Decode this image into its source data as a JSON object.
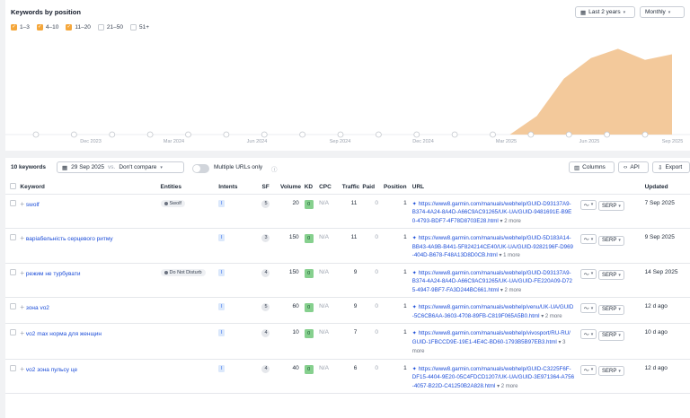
{
  "chart_panel": {
    "title": "Keywords by position",
    "legend": [
      {
        "label": "1–3",
        "checked": true
      },
      {
        "label": "4–10",
        "checked": true
      },
      {
        "label": "11–20",
        "checked": true
      },
      {
        "label": "21–50",
        "checked": false
      },
      {
        "label": "51+",
        "checked": false
      }
    ],
    "period_label": "Last 2 years",
    "interval_label": "Monthly"
  },
  "chart_data": {
    "type": "area",
    "x_labels": [
      "Dec 2023",
      "Mar 2024",
      "Jun 2024",
      "Sep 2024",
      "Dec 2024",
      "Mar 2025",
      "Jun 2025",
      "Sep 2025"
    ],
    "series": [
      {
        "values": [
          0,
          0,
          0,
          0,
          0,
          0,
          0,
          0,
          0,
          0,
          0,
          0,
          0,
          0,
          0,
          0,
          0,
          0,
          0,
          1,
          3,
          4.1,
          4.6,
          4.0,
          4.3
        ]
      }
    ],
    "area_color": "#f3c99b",
    "event_markers": 17
  },
  "table_panel": {
    "count_label": "10 keywords",
    "date_label": "29 Sep 2025",
    "vs_label": "vs.",
    "compare_label": "Don't compare",
    "multiple_urls_label": "Multiple URLs only",
    "columns_label": "Columns",
    "api_label": "API",
    "export_label": "Export",
    "headers": {
      "keyword": "Keyword",
      "entities": "Entities",
      "intents": "Intents",
      "sf": "SF",
      "volume": "Volume",
      "kd": "KD",
      "cpc": "CPC",
      "traffic": "Traffic",
      "paid": "Paid",
      "position": "Position",
      "url": "URL",
      "updated": "Updated"
    },
    "rows": [
      {
        "keyword": "swolf",
        "entity": "Swolf",
        "intent": "I",
        "sf": "5",
        "volume": "20",
        "kd": "0",
        "cpc": "N/A",
        "traffic": "11",
        "paid": "0",
        "position": "1",
        "url": "https://www8.garmin.com/manuals/webhelp/GUID-D93137A9-B374-4A24-8A4D-A66C9AC91265/UK-UA/GUID-9481691E-B9E0-4793-BDF7-4F78D8703E28.html",
        "more": "2 more",
        "serp": "SERP",
        "updated": "7 Sep 2025"
      },
      {
        "keyword": "варіабельність серцевого ритму",
        "entity": "",
        "intent": "I",
        "sf": "3",
        "volume": "150",
        "kd": "0",
        "cpc": "N/A",
        "traffic": "11",
        "paid": "0",
        "position": "1",
        "url": "https://www8.garmin.com/manuals/webhelp/GUID-5D183A14-BB43-4A9B-B441-5F824214CE40/UK-UA/GUID-9282196F-D969-404D-B678-F48A13D8D0CB.html",
        "more": "1 more",
        "serp": "SERP",
        "updated": "9 Sep 2025"
      },
      {
        "keyword": "режим не турбувати",
        "entity": "Do Not Disturb",
        "intent": "I",
        "sf": "4",
        "volume": "150",
        "kd": "0",
        "cpc": "N/A",
        "traffic": "9",
        "paid": "0",
        "position": "1",
        "url": "https://www8.garmin.com/manuals/webhelp/GUID-D93137A9-B374-4A24-8A4D-A66C9AC91265/UK-UA/GUID-FE220A09-D725-4947-9BF7-FA3D244BC661.html",
        "more": "2 more",
        "serp": "SERP",
        "updated": "14 Sep 2025"
      },
      {
        "keyword": "зона vo2",
        "entity": "",
        "intent": "I",
        "sf": "5",
        "volume": "60",
        "kd": "0",
        "cpc": "N/A",
        "traffic": "9",
        "paid": "0",
        "position": "1",
        "url": "https://www8.garmin.com/manuals/webhelp/venu/UK-UA/GUID-5C6CB6AA-3603-4708-89FB-C819F065A5B0.html",
        "more": "2 more",
        "serp": "SERP",
        "updated": "12 d ago"
      },
      {
        "keyword": "vo2 max норма для женщин",
        "entity": "",
        "intent": "I",
        "sf": "4",
        "volume": "10",
        "kd": "0",
        "cpc": "N/A",
        "traffic": "7",
        "paid": "0",
        "position": "1",
        "url": "https://www8.garmin.com/manuals/webhelp/vivosport/RU-RU/GUID-1FBCCD9E-19E1-4E4C-BD60-1793B5B97EB3.html",
        "more": "3 more",
        "serp": "SERP",
        "updated": "10 d ago"
      },
      {
        "keyword": "vo2 зона пульсу це",
        "entity": "",
        "intent": "I",
        "sf": "4",
        "volume": "40",
        "kd": "0",
        "cpc": "N/A",
        "traffic": "6",
        "paid": "0",
        "position": "1",
        "url": "https://www8.garmin.com/manuals/webhelp/GUID-C3225F6F-DF15-4404-9E20-05C4FDCD1207/UK-UA/GUID-3E971364-A756-4057-B22D-C41250B2A828.html",
        "more": "2 more",
        "serp": "SERP",
        "updated": "12 d ago"
      }
    ]
  }
}
